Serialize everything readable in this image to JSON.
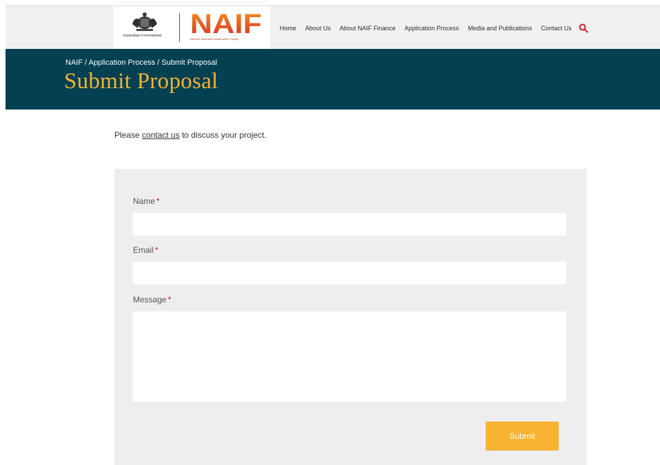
{
  "header": {
    "gov_label": "Australian Government",
    "brand": "NAIF",
    "brand_tagline": "Northern Australia Infrastructure Facility",
    "brand_colors": {
      "orange": "#f7941d",
      "red": "#d62b2b"
    },
    "nav": [
      {
        "label": "Home"
      },
      {
        "label": "About Us"
      },
      {
        "label": "About NAIF Finance"
      },
      {
        "label": "Application Process"
      },
      {
        "label": "Media and Publications"
      },
      {
        "label": "Contact Us"
      }
    ],
    "search_icon": "search-icon"
  },
  "banner": {
    "breadcrumb": [
      {
        "label": "NAIF"
      },
      {
        "label": "Application Process"
      },
      {
        "label": "Submit Proposal"
      }
    ],
    "separator": " / ",
    "title": "Submit Proposal",
    "background": "#024052",
    "title_color": "#f5b335"
  },
  "intro": {
    "before": "Please ",
    "link": "contact us",
    "after": " to discuss your project."
  },
  "form": {
    "required_marker": "*",
    "fields": [
      {
        "label": "Name",
        "value": ""
      },
      {
        "label": "Email",
        "value": ""
      },
      {
        "label": "Message",
        "value": ""
      }
    ],
    "submit_label": "Submit",
    "accent": "#f8b333"
  }
}
